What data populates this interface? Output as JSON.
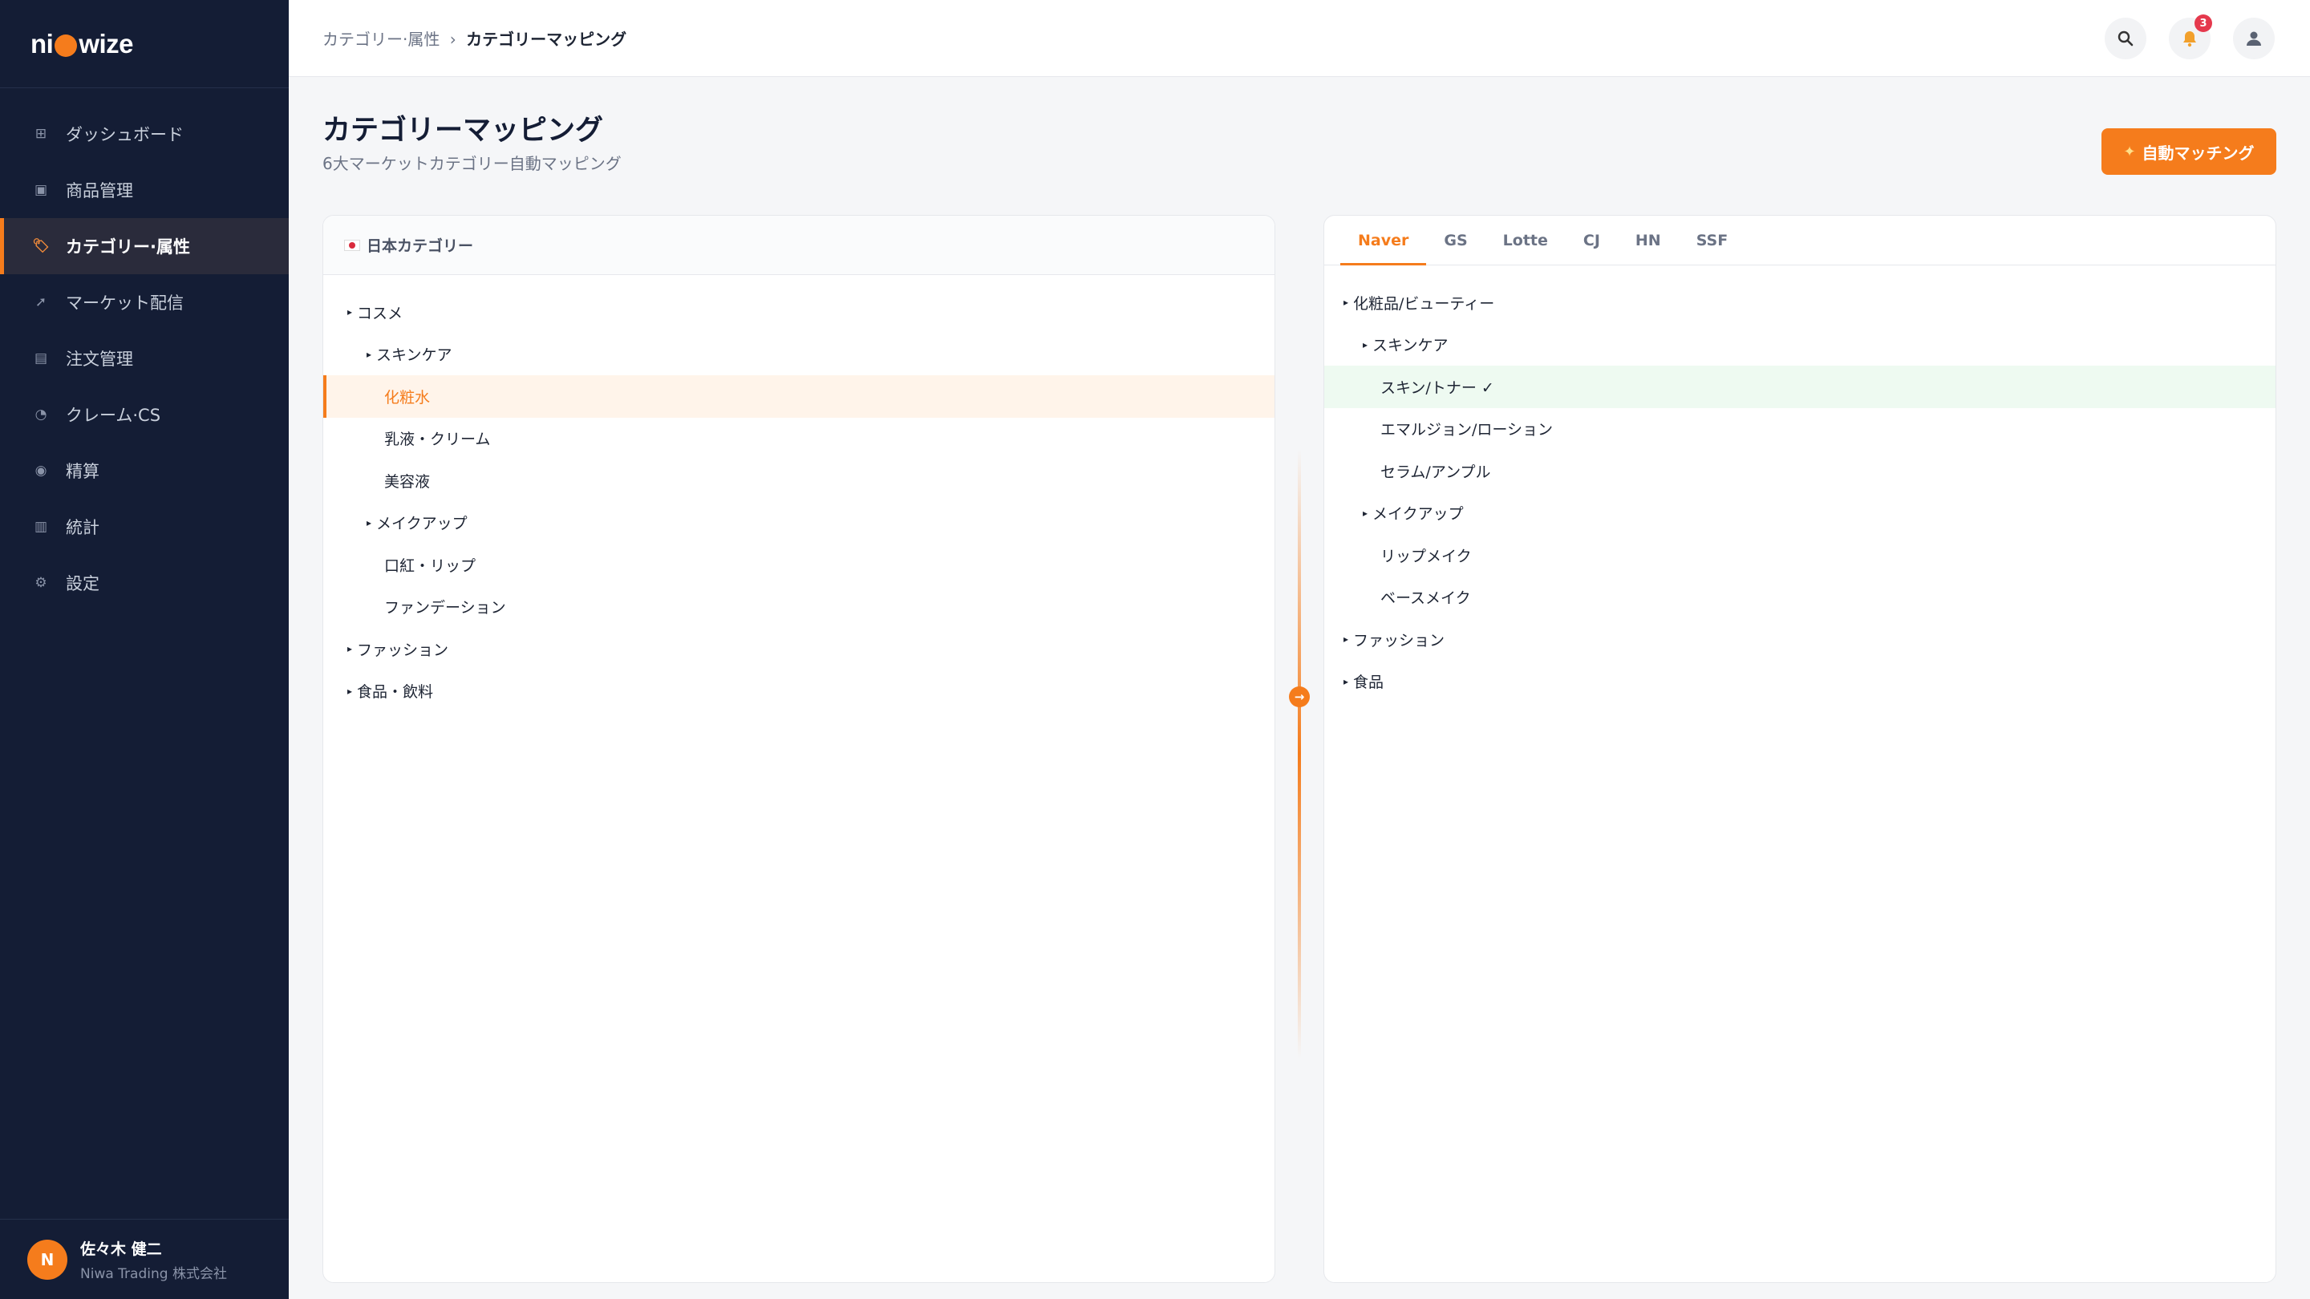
{
  "brand": {
    "logo_left": "ni",
    "logo_right": "wize",
    "accent": "#f57c1c"
  },
  "sidebar": {
    "items": [
      {
        "label": "ダッシュボード",
        "icon": "grid-icon",
        "active": false
      },
      {
        "label": "商品管理",
        "icon": "box-icon",
        "active": false
      },
      {
        "label": "カテゴリー·属性",
        "icon": "tag-icon",
        "active": true
      },
      {
        "label": "マーケット配信",
        "icon": "rocket-icon",
        "active": false
      },
      {
        "label": "注文管理",
        "icon": "clipboard-icon",
        "active": false
      },
      {
        "label": "クレーム·CS",
        "icon": "chat-bubble-icon",
        "active": false
      },
      {
        "label": "精算",
        "icon": "money-bag-icon",
        "active": false
      },
      {
        "label": "統計",
        "icon": "bar-chart-icon",
        "active": false
      },
      {
        "label": "設定",
        "icon": "gear-icon",
        "active": false
      }
    ],
    "user": {
      "initial": "N",
      "name": "佐々木 健二",
      "org": "Niwa Trading 株式会社"
    }
  },
  "header": {
    "breadcrumb_parent": "カテゴリー·属性",
    "breadcrumb_sep": "›",
    "breadcrumb_current": "カテゴリーマッピング",
    "notification_count": "3"
  },
  "page": {
    "title": "カテゴリーマッピング",
    "subtitle": "6大マーケットカテゴリー自動マッピング",
    "auto_button": "自動マッチング"
  },
  "left_panel": {
    "title": "日本カテゴリー",
    "tree": [
      {
        "label": "コスメ",
        "level": 0,
        "expandable": true
      },
      {
        "label": "スキンケア",
        "level": 1,
        "expandable": true
      },
      {
        "label": "化粧水",
        "level": 2,
        "selected": true
      },
      {
        "label": "乳液・クリーム",
        "level": 2
      },
      {
        "label": "美容液",
        "level": 2
      },
      {
        "label": "メイクアップ",
        "level": 1,
        "expandable": true
      },
      {
        "label": "口紅・リップ",
        "level": 2
      },
      {
        "label": "ファンデーション",
        "level": 2
      },
      {
        "label": "ファッション",
        "level": 0,
        "expandable": true
      },
      {
        "label": "食品・飲料",
        "level": 0,
        "expandable": true
      }
    ]
  },
  "right_panel": {
    "tabs": [
      {
        "label": "Naver",
        "active": true
      },
      {
        "label": "GS"
      },
      {
        "label": "Lotte"
      },
      {
        "label": "CJ"
      },
      {
        "label": "HN"
      },
      {
        "label": "SSF"
      }
    ],
    "tree": [
      {
        "label": "化粧品/ビューティー",
        "level": 0,
        "expandable": true
      },
      {
        "label": "スキンケア",
        "level": 1,
        "expandable": true
      },
      {
        "label": "スキン/トナー ✓",
        "level": 2,
        "matched": true
      },
      {
        "label": "エマルジョン/ローション",
        "level": 2
      },
      {
        "label": "セラム/アンプル",
        "level": 2
      },
      {
        "label": "メイクアップ",
        "level": 1,
        "expandable": true
      },
      {
        "label": "リップメイク",
        "level": 2
      },
      {
        "label": "ベースメイク",
        "level": 2
      },
      {
        "label": "ファッション",
        "level": 0,
        "expandable": true
      },
      {
        "label": "食品",
        "level": 0,
        "expandable": true
      }
    ]
  }
}
